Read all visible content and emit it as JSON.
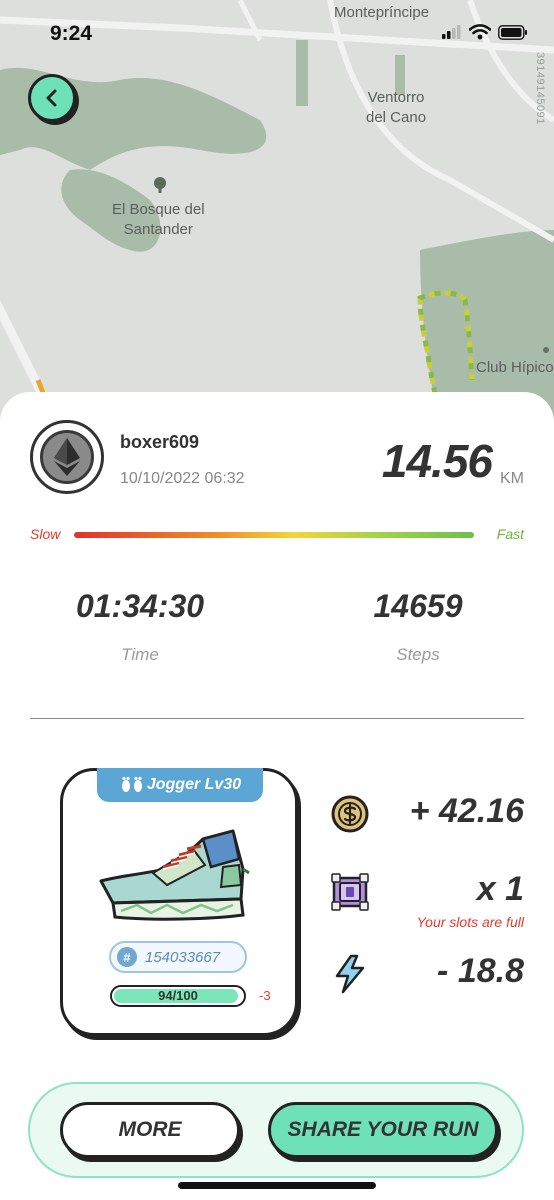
{
  "status_bar": {
    "time": "9:24"
  },
  "map": {
    "labels": {
      "monteprincipe": "Montepríncipe",
      "ventorro": "Ventorro\ndel Cano",
      "bosque": "El Bosque del\nSantander",
      "club": "Club Hípico"
    },
    "vertical_code": "39149145091"
  },
  "user": {
    "name": "boxer609",
    "datetime": "10/10/2022 06:32",
    "avatar_icon": "ethereum-icon"
  },
  "run": {
    "distance": "14.56",
    "distance_unit": "KM",
    "speed_slow_label": "Slow",
    "speed_fast_label": "Fast",
    "time": "01:34:30",
    "time_label": "Time",
    "steps": "14659",
    "steps_label": "Steps"
  },
  "sneaker": {
    "level_label": "Jogger Lv30",
    "id": "154033667",
    "durability_text": "94/100",
    "durability_fraction": 0.94,
    "durability_delta": "-3"
  },
  "rewards": {
    "gst": "+ 42.16",
    "mystery_box": "x 1",
    "mystery_box_note": "Your slots are full",
    "energy": "- 18.8"
  },
  "actions": {
    "more_label": "MORE",
    "share_label": "SHARE YOUR RUN"
  },
  "colors": {
    "accent": "#6fe1b8",
    "tab_blue": "#5ba6d5",
    "slow_red": "#e53a2a",
    "fast_green": "#6ab83a"
  }
}
